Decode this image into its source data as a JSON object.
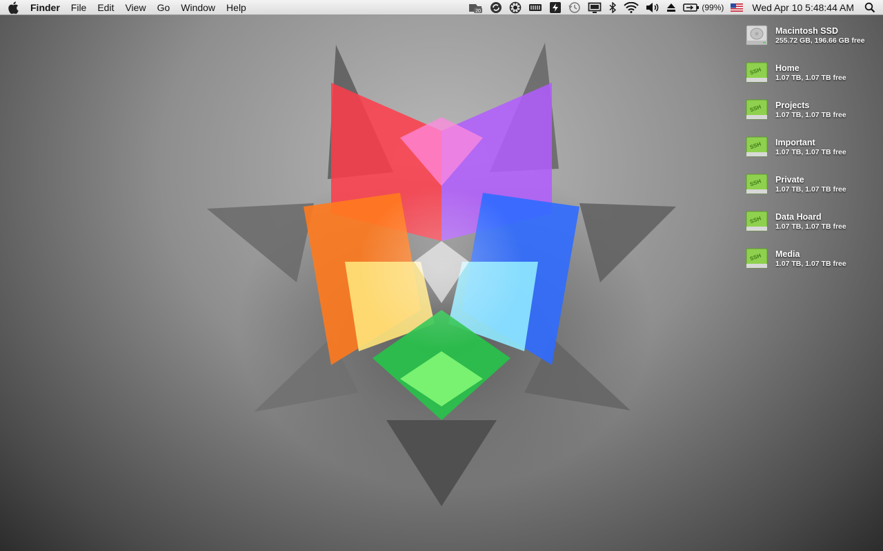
{
  "menubar": {
    "apple_icon": "apple-logo",
    "app_name": "Finder",
    "menus": [
      "File",
      "Edit",
      "View",
      "Go",
      "Window",
      "Help"
    ],
    "status": {
      "notification_badge": "20",
      "battery_percent": "(99%)",
      "clock": "Wed Apr 10  5:48:44 AM",
      "icons": [
        "dropzone-icon",
        "sync-icon",
        "gear-monitor-icon",
        "memory-icon",
        "flux-icon",
        "time-machine-icon",
        "display-icon",
        "bluetooth-icon",
        "wifi-icon",
        "volume-icon",
        "eject-icon",
        "battery-icon",
        "us-flag-icon",
        "spotlight-icon"
      ]
    }
  },
  "desktop": {
    "volumes": [
      {
        "name": "Macintosh SSD",
        "info": "255.72 GB, 196.66 GB free",
        "icon": "internal-drive-icon"
      },
      {
        "name": "Home",
        "info": "1.07 TB, 1.07 TB free",
        "icon": "ssh-drive-icon"
      },
      {
        "name": "Projects",
        "info": "1.07 TB, 1.07 TB free",
        "icon": "ssh-drive-icon"
      },
      {
        "name": "Important",
        "info": "1.07 TB, 1.07 TB free",
        "icon": "ssh-drive-icon"
      },
      {
        "name": "Private",
        "info": "1.07 TB, 1.07 TB free",
        "icon": "ssh-drive-icon"
      },
      {
        "name": "Data Hoard",
        "info": "1.07 TB, 1.07 TB free",
        "icon": "ssh-drive-icon"
      },
      {
        "name": "Media",
        "info": "1.07 TB, 1.07 TB free",
        "icon": "ssh-drive-icon"
      }
    ],
    "ssh_badge_text": "SSH"
  },
  "colors": {
    "menubar_top": "#f4f4f4",
    "menubar_bottom": "#dcdcdc",
    "ssh_drive_green": "#8fd14f"
  }
}
